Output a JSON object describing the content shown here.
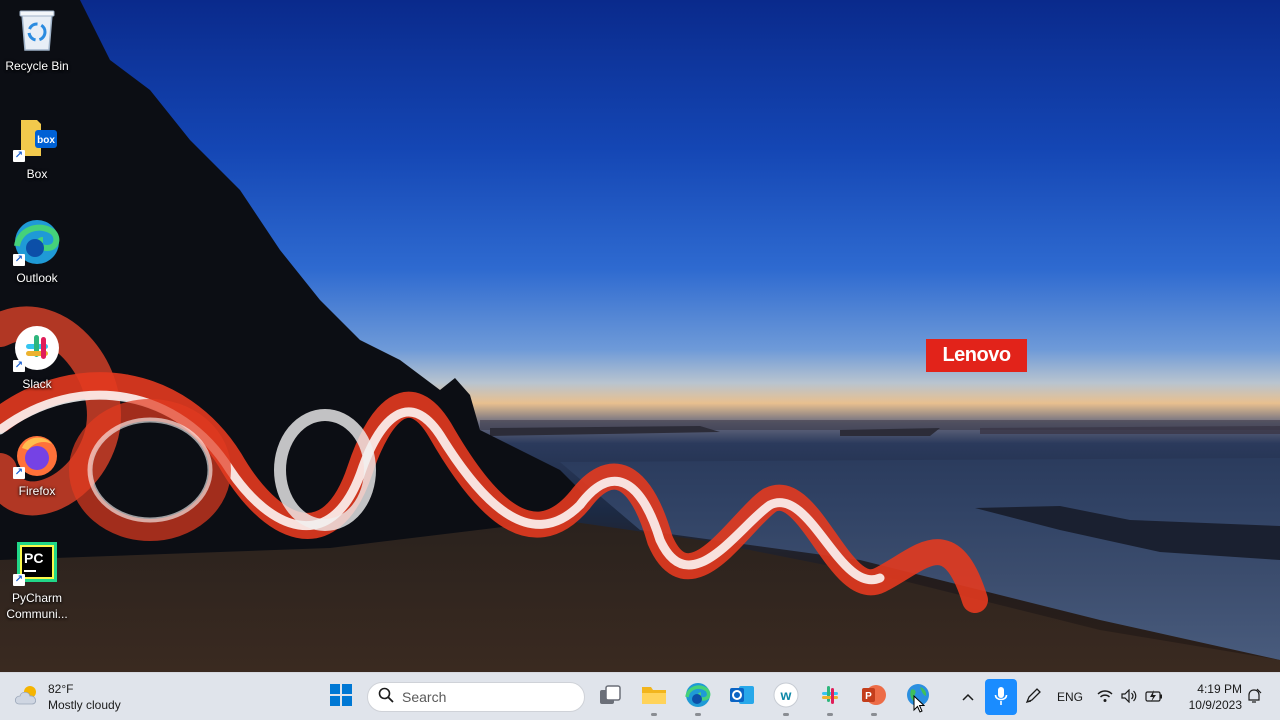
{
  "wallpaper": {
    "brand": "Lenovo"
  },
  "desktop_icons": [
    {
      "label": "Recycle Bin",
      "icon": "recycle-bin-icon"
    },
    {
      "label": "Box",
      "icon": "box-icon"
    },
    {
      "label": "Outlook",
      "icon": "outlook-icon"
    },
    {
      "label": "Slack",
      "icon": "slack-icon"
    },
    {
      "label": "Firefox",
      "icon": "firefox-icon"
    },
    {
      "label": "PyCharm Communi...",
      "icon": "pycharm-icon"
    }
  ],
  "taskbar": {
    "weather": {
      "temperature": "82°F",
      "condition": "Mostly cloudy",
      "icon": "partly-cloudy-icon"
    },
    "search": {
      "placeholder": "Search"
    },
    "pinned": [
      {
        "name": "start",
        "icon": "windows-logo-icon"
      },
      {
        "name": "task-view",
        "icon": "task-view-icon"
      },
      {
        "name": "file-explorer",
        "icon": "folder-icon"
      },
      {
        "name": "edge",
        "icon": "edge-icon"
      },
      {
        "name": "outlook",
        "icon": "outlook-icon"
      },
      {
        "name": "webex",
        "icon": "webex-icon"
      },
      {
        "name": "slack",
        "icon": "slack-icon"
      },
      {
        "name": "powerpoint",
        "icon": "powerpoint-icon"
      },
      {
        "name": "globe-app",
        "icon": "globe-icon"
      }
    ],
    "tray": {
      "language": "ENG"
    },
    "clock": {
      "time": "4:19 PM",
      "date": "10/9/2023"
    }
  },
  "colors": {
    "lenovo_red": "#e2231a",
    "taskbar_bg": "#e9ecf3",
    "accent_blue": "#1a8cff"
  }
}
